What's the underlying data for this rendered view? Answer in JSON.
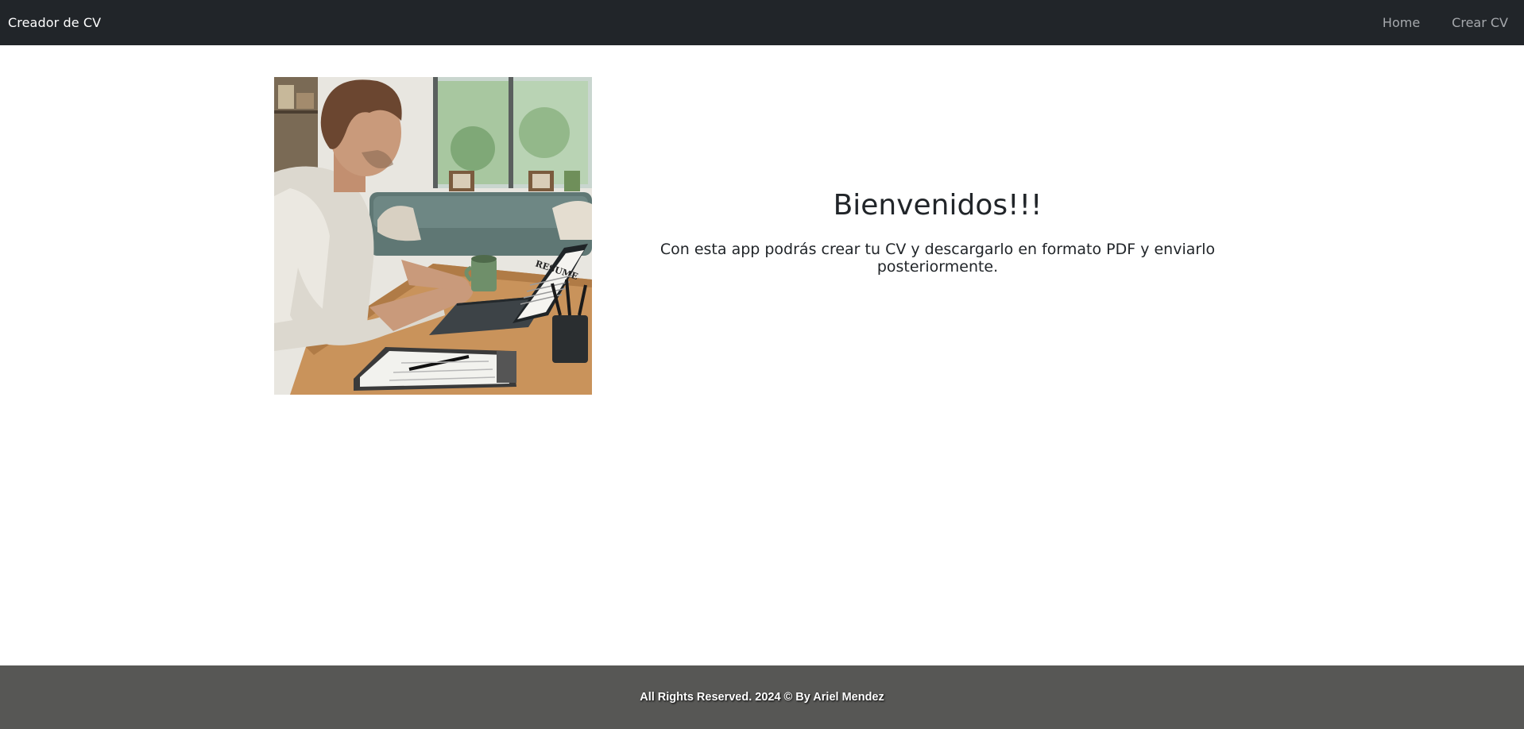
{
  "navbar": {
    "brand": "Creador de CV",
    "links": [
      {
        "label": "Home"
      },
      {
        "label": "Crear CV"
      }
    ]
  },
  "hero": {
    "image_lettering": "RESUME",
    "title": "Bienvenidos!!!",
    "description": "Con esta app podrás crear tu CV y descargarlo en formato PDF y enviarlo posteriormente."
  },
  "footer": {
    "text": "All Rights Reserved. 2024 © By Ariel Mendez"
  },
  "colors": {
    "navbar_bg": "#212529",
    "footer_bg": "#575755",
    "nav_link": "#a6a9ad"
  }
}
